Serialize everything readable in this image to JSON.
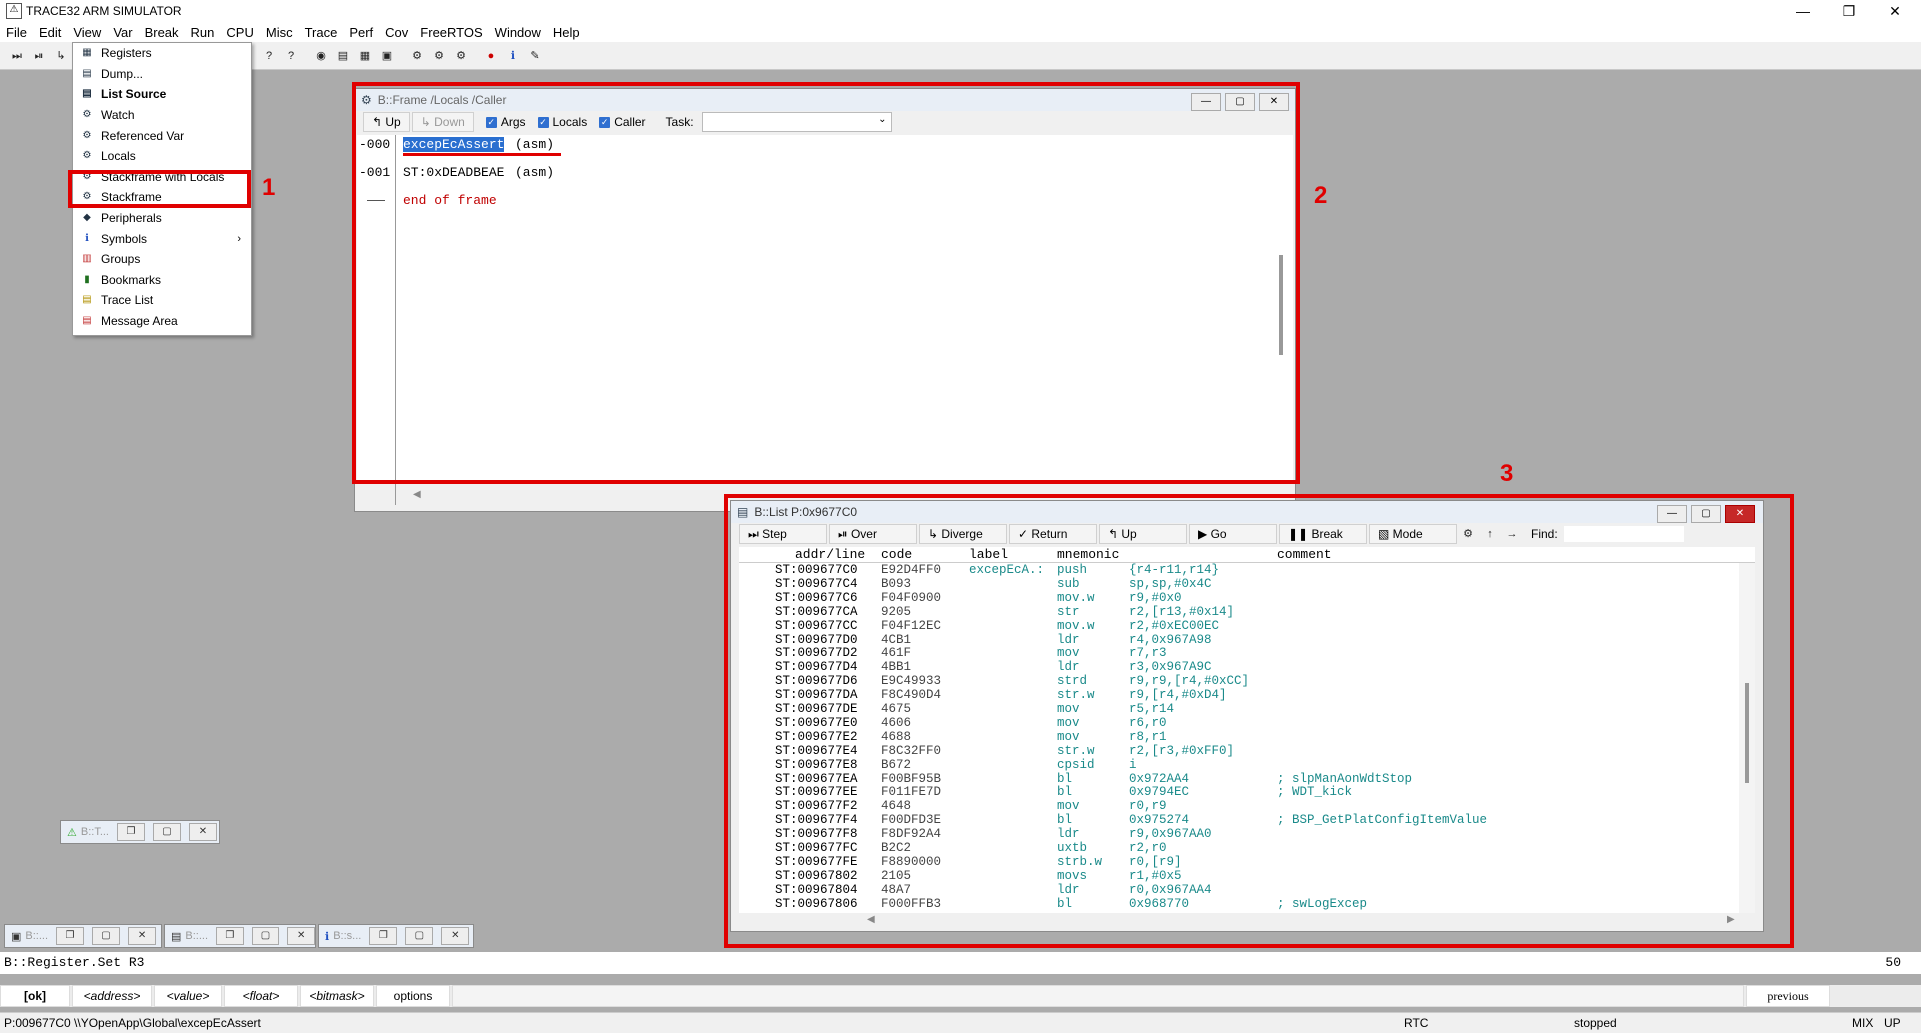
{
  "app": {
    "title": "TRACE32 ARM SIMULATOR"
  },
  "menubar": [
    "File",
    "Edit",
    "View",
    "Var",
    "Break",
    "Run",
    "CPU",
    "Misc",
    "Trace",
    "Perf",
    "Cov",
    "FreeRTOS",
    "Window",
    "Help"
  ],
  "view_menu": [
    {
      "label": "Registers",
      "icon": "registers-icon",
      "bold": false
    },
    {
      "label": "Dump...",
      "icon": "dump-icon",
      "bold": false
    },
    {
      "label": "List Source",
      "icon": "list-icon",
      "bold": true
    },
    {
      "label": "Watch",
      "icon": "watch-icon",
      "bold": false
    },
    {
      "label": "Referenced Var",
      "icon": "var-icon",
      "bold": false
    },
    {
      "label": "Locals",
      "icon": "locals-icon",
      "bold": false
    },
    {
      "label": "Stackframe with Locals",
      "icon": "stackframe-icon",
      "bold": false
    },
    {
      "label": "Stackframe",
      "icon": "stackframe-icon",
      "bold": false
    },
    {
      "label": "Peripherals",
      "icon": "peripherals-icon",
      "bold": false
    },
    {
      "label": "Symbols",
      "icon": "symbols-icon",
      "bold": false,
      "submenu": true
    },
    {
      "label": "Groups",
      "icon": "groups-icon",
      "bold": false
    },
    {
      "label": "Bookmarks",
      "icon": "bookmark-icon",
      "bold": false
    },
    {
      "label": "Trace List",
      "icon": "trace-icon",
      "bold": false
    },
    {
      "label": "Message Area",
      "icon": "message-icon",
      "bold": false
    }
  ],
  "annotations": {
    "label1": "1",
    "label2": "2",
    "label3": "3"
  },
  "frame_window": {
    "title": "B::Frame /Locals /Caller",
    "toolbar": {
      "up": "Up",
      "down": "Down",
      "args": "Args",
      "locals": "Locals",
      "caller": "Caller",
      "task_label": "Task:"
    },
    "rows": [
      {
        "level": "-000",
        "func": "excepEcAssert",
        "suffix": "(asm)"
      },
      {
        "level": "-001",
        "func": "ST:0xDEADBEAE",
        "suffix": "(asm)"
      },
      {
        "level": "",
        "func": "end of frame",
        "suffix": ""
      }
    ]
  },
  "list_window": {
    "title": "B::List P:0x9677C0",
    "toolbar": {
      "step": "Step",
      "over": "Over",
      "diverge": "Diverge",
      "return": "Return",
      "up": "Up",
      "go": "Go",
      "break": "Break",
      "mode": "Mode",
      "find": "Find:"
    },
    "headers": {
      "addr": "addr/line",
      "code": "code",
      "label": "label",
      "mnemonic": "mnemonic",
      "comment": "comment"
    },
    "rows": [
      {
        "addr": "ST:009677C0",
        "code": "E92D4FF0",
        "label": "excepEcA.:",
        "mn": "push",
        "op": "{r4-r11,r14}",
        "cm": ""
      },
      {
        "addr": "ST:009677C4",
        "code": "B093",
        "label": "",
        "mn": "sub",
        "op": "sp,sp,#0x4C",
        "cm": ""
      },
      {
        "addr": "ST:009677C6",
        "code": "F04F0900",
        "label": "",
        "mn": "mov.w",
        "op": "r9,#0x0",
        "cm": ""
      },
      {
        "addr": "ST:009677CA",
        "code": "9205",
        "label": "",
        "mn": "str",
        "op": "r2,[r13,#0x14]",
        "cm": ""
      },
      {
        "addr": "ST:009677CC",
        "code": "F04F12EC",
        "label": "",
        "mn": "mov.w",
        "op": "r2,#0xEC00EC",
        "cm": ""
      },
      {
        "addr": "ST:009677D0",
        "code": "4CB1",
        "label": "",
        "mn": "ldr",
        "op": "r4,0x967A98",
        "cm": ""
      },
      {
        "addr": "ST:009677D2",
        "code": "461F",
        "label": "",
        "mn": "mov",
        "op": "r7,r3",
        "cm": ""
      },
      {
        "addr": "ST:009677D4",
        "code": "4BB1",
        "label": "",
        "mn": "ldr",
        "op": "r3,0x967A9C",
        "cm": ""
      },
      {
        "addr": "ST:009677D6",
        "code": "E9C49933",
        "label": "",
        "mn": "strd",
        "op": "r9,r9,[r4,#0xCC]",
        "cm": ""
      },
      {
        "addr": "ST:009677DA",
        "code": "F8C490D4",
        "label": "",
        "mn": "str.w",
        "op": "r9,[r4,#0xD4]",
        "cm": ""
      },
      {
        "addr": "ST:009677DE",
        "code": "4675",
        "label": "",
        "mn": "mov",
        "op": "r5,r14",
        "cm": ""
      },
      {
        "addr": "ST:009677E0",
        "code": "4606",
        "label": "",
        "mn": "mov",
        "op": "r6,r0",
        "cm": ""
      },
      {
        "addr": "ST:009677E2",
        "code": "4688",
        "label": "",
        "mn": "mov",
        "op": "r8,r1",
        "cm": ""
      },
      {
        "addr": "ST:009677E4",
        "code": "F8C32FF0",
        "label": "",
        "mn": "str.w",
        "op": "r2,[r3,#0xFF0]",
        "cm": ""
      },
      {
        "addr": "ST:009677E8",
        "code": "B672",
        "label": "",
        "mn": "cpsid",
        "op": "i",
        "cm": ""
      },
      {
        "addr": "ST:009677EA",
        "code": "F00BF95B",
        "label": "",
        "mn": "bl",
        "op": "0x972AA4",
        "cm": "; slpManAonWdtStop"
      },
      {
        "addr": "ST:009677EE",
        "code": "F011FE7D",
        "label": "",
        "mn": "bl",
        "op": "0x9794EC",
        "cm": "; WDT_kick"
      },
      {
        "addr": "ST:009677F2",
        "code": "4648",
        "label": "",
        "mn": "mov",
        "op": "r0,r9",
        "cm": ""
      },
      {
        "addr": "ST:009677F4",
        "code": "F00DFD3E",
        "label": "",
        "mn": "bl",
        "op": "0x975274",
        "cm": "; BSP_GetPlatConfigItemValue"
      },
      {
        "addr": "ST:009677F8",
        "code": "F8DF92A4",
        "label": "",
        "mn": "ldr",
        "op": "r9,0x967AA0",
        "cm": ""
      },
      {
        "addr": "ST:009677FC",
        "code": "B2C2",
        "label": "",
        "mn": "uxtb",
        "op": "r2,r0",
        "cm": ""
      },
      {
        "addr": "ST:009677FE",
        "code": "F8890000",
        "label": "",
        "mn": "strb.w",
        "op": "r0,[r9]",
        "cm": ""
      },
      {
        "addr": "ST:00967802",
        "code": "2105",
        "label": "",
        "mn": "movs",
        "op": "r1,#0x5",
        "cm": ""
      },
      {
        "addr": "ST:00967804",
        "code": "48A7",
        "label": "",
        "mn": "ldr",
        "op": "r0,0x967AA4",
        "cm": ""
      },
      {
        "addr": "ST:00967806",
        "code": "F000FFB3",
        "label": "",
        "mn": "bl",
        "op": "0x968770",
        "cm": "; swLogExcep"
      }
    ]
  },
  "minimized": [
    {
      "title": "B::T..."
    },
    {
      "title": "B::..."
    },
    {
      "title": "B::..."
    },
    {
      "title": "B::s..."
    }
  ],
  "command": {
    "text": "B::Register.Set R3",
    "right": "50"
  },
  "softkeys": [
    "[ok]",
    "<address>",
    "<value>",
    "<float>",
    "<bitmask>",
    "options",
    "previous"
  ],
  "status": {
    "address": "P:009677C0  \\\\YOpenApp\\Global\\excepEcAssert",
    "rtc": "RTC",
    "state": "stopped",
    "mix": "MIX",
    "up": "UP"
  }
}
